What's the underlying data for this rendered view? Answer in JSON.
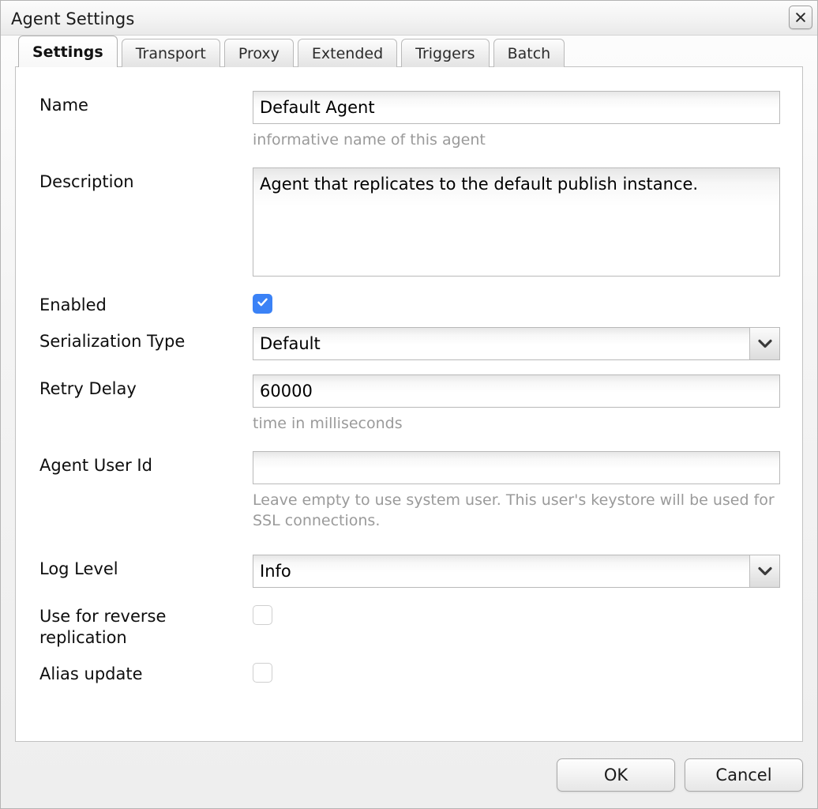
{
  "window": {
    "title": "Agent Settings",
    "close_icon": "close-icon"
  },
  "tabs": [
    {
      "label": "Settings",
      "active": true
    },
    {
      "label": "Transport",
      "active": false
    },
    {
      "label": "Proxy",
      "active": false
    },
    {
      "label": "Extended",
      "active": false
    },
    {
      "label": "Triggers",
      "active": false
    },
    {
      "label": "Batch",
      "active": false
    }
  ],
  "form": {
    "name": {
      "label": "Name",
      "value": "Default Agent",
      "hint": "informative name of this agent"
    },
    "description": {
      "label": "Description",
      "value": "Agent that replicates to the default publish instance."
    },
    "enabled": {
      "label": "Enabled",
      "checked": true
    },
    "serialization_type": {
      "label": "Serialization Type",
      "value": "Default",
      "arrow_icon": "chevron-down-icon"
    },
    "retry_delay": {
      "label": "Retry Delay",
      "value": "60000",
      "hint": "time in milliseconds"
    },
    "agent_user_id": {
      "label": "Agent User Id",
      "value": "",
      "hint": "Leave empty to use system user. This user's keystore will be used for SSL connections."
    },
    "log_level": {
      "label": "Log Level",
      "value": "Info",
      "arrow_icon": "chevron-down-icon"
    },
    "reverse_replication": {
      "label": "Use for reverse replication",
      "checked": false
    },
    "alias_update": {
      "label": "Alias update",
      "checked": false
    }
  },
  "footer": {
    "ok_label": "OK",
    "cancel_label": "Cancel"
  },
  "colors": {
    "checkbox_checked": "#3b82f6",
    "hint_text": "#9a9a9a"
  }
}
